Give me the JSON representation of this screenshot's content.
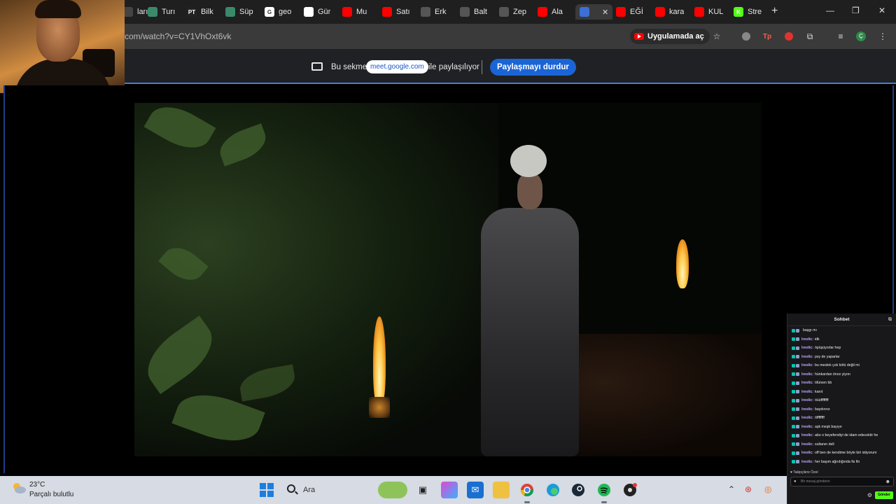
{
  "browser": {
    "tabs": [
      {
        "label": "ları",
        "fav_color": "#444444",
        "fav_text": ""
      },
      {
        "label": "Turı",
        "fav_color": "#3a8a6a",
        "fav_text": ""
      },
      {
        "label": "Bilk",
        "fav_color": "#222222",
        "fav_text": "PT"
      },
      {
        "label": "Süp",
        "fav_color": "#3a8a6a",
        "fav_text": ""
      },
      {
        "label": "geo",
        "fav_color": "#ffffff",
        "fav_text": "G"
      },
      {
        "label": "Gür",
        "fav_color": "#ffffff",
        "fav_text": ""
      },
      {
        "label": "Mu",
        "fav_color": "#ff0000",
        "fav_text": ""
      },
      {
        "label": "Satı",
        "fav_color": "#ff0000",
        "fav_text": ""
      },
      {
        "label": "Erk",
        "fav_color": "#555555",
        "fav_text": ""
      },
      {
        "label": "Balt",
        "fav_color": "#555555",
        "fav_text": ""
      },
      {
        "label": "Zep",
        "fav_color": "#555555",
        "fav_text": ""
      },
      {
        "label": "Ala",
        "fav_color": "#ff0000",
        "fav_text": ""
      },
      {
        "label": "",
        "fav_color": "#3d6fd6",
        "fav_text": ""
      },
      {
        "label": "EĞİ",
        "fav_color": "#ff0000",
        "fav_text": ""
      },
      {
        "label": "kara",
        "fav_color": "#ff0000",
        "fav_text": ""
      },
      {
        "label": "KUL",
        "fav_color": "#ff0000",
        "fav_text": ""
      },
      {
        "label": "Stre",
        "fav_color": "#53fc18",
        "fav_text": "K"
      }
    ],
    "url": "com/watch?v=CY1VhOxt6vk",
    "open_in_app": "Uygulamada aç"
  },
  "share_bar": {
    "prefix": "Bu sekme",
    "domain": "meet.google.com",
    "suffix": "ile paylaşılıyor",
    "stop_button": "Paylaşmayı durdur"
  },
  "chat": {
    "title": "Sohbet",
    "messages": [
      {
        "user": "",
        "text": "başgı mı"
      },
      {
        "user": "lreolic:",
        "text": "idk"
      },
      {
        "user": "lreolic:",
        "text": "öpüşüyorlar hep"
      },
      {
        "user": "lreolic:",
        "text": "psy de yaparlar"
      },
      {
        "user": "lreolic:",
        "text": "bu meslek çok kötü değil mi"
      },
      {
        "user": "lreolic:",
        "text": "hünkardan önce yiyon"
      },
      {
        "user": "lreolic:",
        "text": "ölürsen bb"
      },
      {
        "user": "lreolic:",
        "text": "kanıt"
      },
      {
        "user": "lreolic:",
        "text": "öüüffffffff"
      },
      {
        "user": "lreolic:",
        "text": "baydırırız"
      },
      {
        "user": "lreolic:",
        "text": "öffffffff"
      },
      {
        "user": "lreolic:",
        "text": "aşk meşk bayıyır"
      },
      {
        "user": "lreolic:",
        "text": "abo o beyefendiyi de idam edecektir he"
      },
      {
        "user": "lreolic:",
        "text": "sultanın deli"
      },
      {
        "user": "lreolic:",
        "text": "off ben de kendime böyle biri istiyorum"
      },
      {
        "user": "lreolic:",
        "text": "her başım ağrıdığında fis fin"
      }
    ],
    "pinned": "Takipçilere Özel",
    "input_placeholder": "Bir mesaj gönderin",
    "send_label": "Gönder"
  },
  "taskbar": {
    "temperature": "23°C",
    "weather_desc": "Parçalı bulutlu",
    "search_label": "Ara"
  },
  "colors": {
    "accent": "#1a64d6",
    "kick_green": "#53fc18",
    "youtube_red": "#ff0000"
  }
}
